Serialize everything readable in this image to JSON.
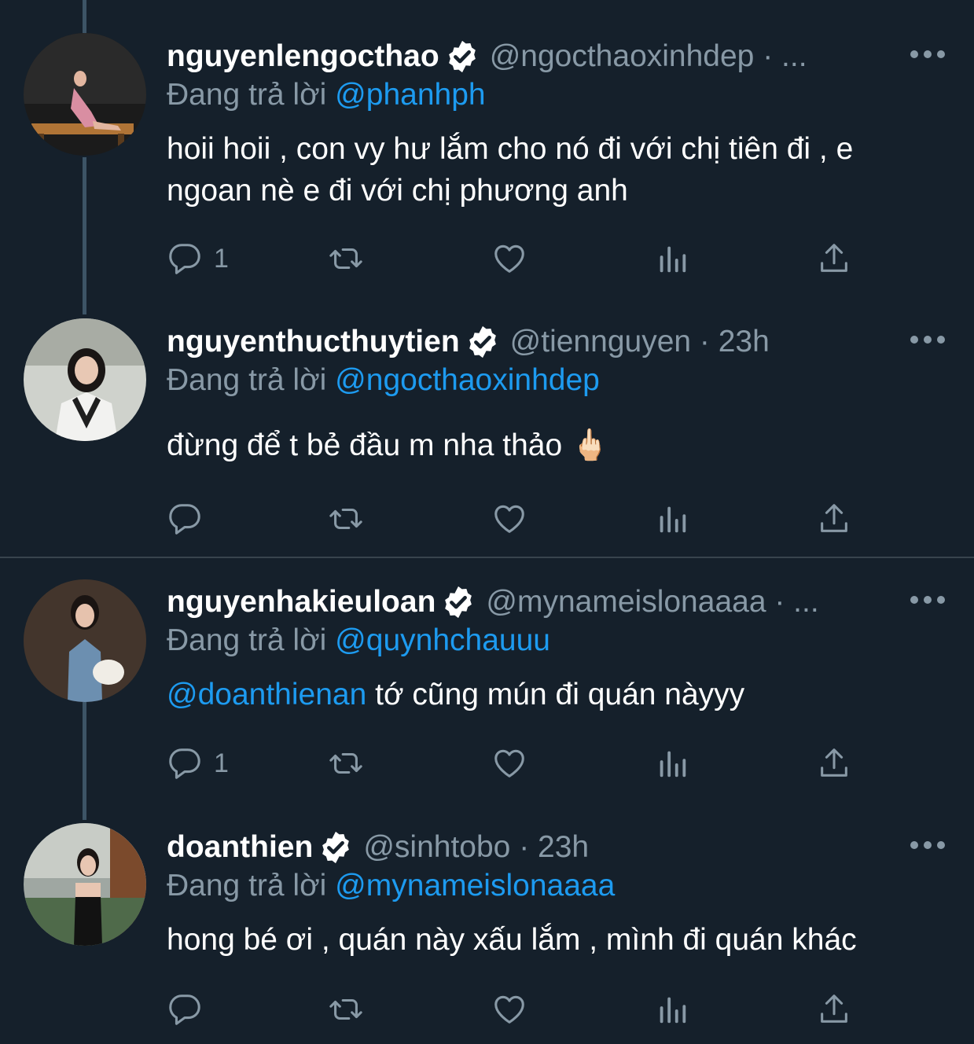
{
  "tweets": [
    {
      "name": "nguyenlengocthao",
      "handle_line": "@ngocthaoxinhdep · ...",
      "reply_label": "Đang trả lời",
      "reply_to": "@phanhph",
      "text_mention": "",
      "text": "hoii hoii , con vy hư lắm cho nó đi với chị tiên đi , e ngoan nè e đi với chị phương anh",
      "reply_count": "1"
    },
    {
      "name": "nguyenthucthuytien",
      "handle_line": "@tiennguyen · 23h",
      "reply_label": "Đang trả lời",
      "reply_to": "@ngocthaoxinhdep",
      "text_mention": "",
      "text": "đừng để t bẻ đầu m nha thảo 🖕🏻",
      "reply_count": ""
    },
    {
      "name": "nguyenhakieuloan",
      "handle_line": "@mynameislonaaaa · ...",
      "reply_label": "Đang trả lời",
      "reply_to": "@quynhchauuu",
      "text_mention": "@doanthienan",
      "text": " tớ cũng mún đi quán nàyyy",
      "reply_count": "1"
    },
    {
      "name": "doanthien",
      "handle_line": "@sinhtobo · 23h",
      "reply_label": "Đang trả lời",
      "reply_to": "@mynameislonaaaa",
      "text_mention": "",
      "text": "hong bé ơi , quán này xấu lắm , mình đi quán khác",
      "reply_count": ""
    }
  ],
  "icons": {
    "verified": "verified-badge-icon",
    "reply": "reply-icon",
    "retweet": "retweet-icon",
    "like": "like-icon",
    "views": "views-icon",
    "share": "share-icon",
    "more": "more-icon"
  },
  "colors": {
    "background": "#15202b",
    "secondary_text": "#8899a6",
    "link": "#1d9bf0",
    "thread_line": "#3d5466",
    "divider": "#38444d"
  }
}
